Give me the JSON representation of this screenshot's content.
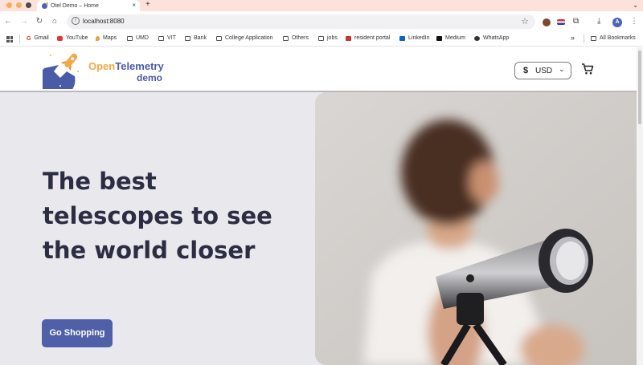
{
  "browser": {
    "tab_title": "Otel Demo – Home",
    "tab_close": "×",
    "new_tab": "+",
    "url": "localhost:8080",
    "bookmarks": [
      {
        "label": "Gmail",
        "icon": "gmail-icon"
      },
      {
        "label": "YouTube",
        "icon": "youtube-icon"
      },
      {
        "label": "Maps",
        "icon": "maps-icon"
      },
      {
        "label": "UMD",
        "icon": "folder-icon"
      },
      {
        "label": "VIT",
        "icon": "folder-icon"
      },
      {
        "label": "Bank",
        "icon": "folder-icon"
      },
      {
        "label": "College Application",
        "icon": "folder-icon"
      },
      {
        "label": "Others",
        "icon": "folder-icon"
      },
      {
        "label": "jobs",
        "icon": "folder-icon"
      },
      {
        "label": "resident portal",
        "icon": "resident-portal-icon"
      },
      {
        "label": "LinkedIn",
        "icon": "linkedin-icon"
      },
      {
        "label": "Medium",
        "icon": "medium-icon"
      },
      {
        "label": "WhatsApp",
        "icon": "whatsapp-icon"
      }
    ],
    "overflow": "»",
    "all_bookmarks": "All Bookmarks",
    "avatar_letter": "A"
  },
  "header": {
    "logo_open": "Open",
    "logo_telemetry": "Telemetry",
    "logo_demo": "demo",
    "currency_symbol": "$",
    "currency_code": "USD",
    "currency_chevron": "⌄"
  },
  "hero": {
    "title": "The best telescopes to see the world closer",
    "button_label": "Go Shopping"
  },
  "colors": {
    "accent": "#4f5fa8",
    "logo_orange": "#f5a742",
    "hero_bg": "#e8e8ed",
    "heading": "#2c2c43",
    "tabbar": "#fde2db"
  }
}
